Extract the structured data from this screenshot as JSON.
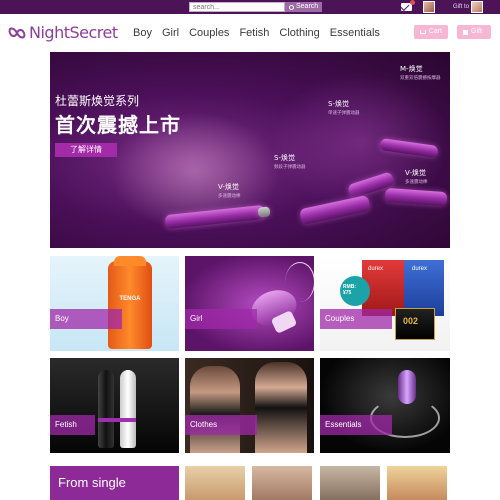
{
  "topbar": {
    "search_placeholder": "search...",
    "search_button": "Search",
    "gift_to_label": "Gift to"
  },
  "header": {
    "logo_text": "NightSecret",
    "nav": [
      "Boy",
      "Girl",
      "Couples",
      "Fetish",
      "Clothing",
      "Essentials"
    ],
    "cart_label": "Cart",
    "gift_label": "Gift"
  },
  "banner": {
    "subtitle": "杜蕾斯焕觉系列",
    "title": "首次震撼上市",
    "button": "了解详情",
    "products": [
      {
        "name": "M-焕觉",
        "desc": "双重双倍震撼按摩器"
      },
      {
        "name": "S-焕觉",
        "desc": "单速子弹震动器"
      },
      {
        "name": "S-焕觉",
        "desc": "频段子弹震动器"
      },
      {
        "name": "V-焕觉",
        "desc": "多速震动棒"
      },
      {
        "name": "V-焕觉",
        "desc": "多速震动棒"
      }
    ]
  },
  "categories": [
    {
      "label": "Boy"
    },
    {
      "label": "Girl"
    },
    {
      "label": "Couples"
    },
    {
      "label": "Fetish"
    },
    {
      "label": "Clothes"
    },
    {
      "label": "Essentials"
    }
  ],
  "tile_text": {
    "tenga": "TENGA",
    "durex": "durex",
    "price": "RMB:\n¥75",
    "zero": "002"
  },
  "single": {
    "label": "From single"
  },
  "colors": {
    "topbar": "#4c1457",
    "brand": "#8e3d9b",
    "accent_pink": "#f6b6d4",
    "tile_label": "#a028aa"
  }
}
